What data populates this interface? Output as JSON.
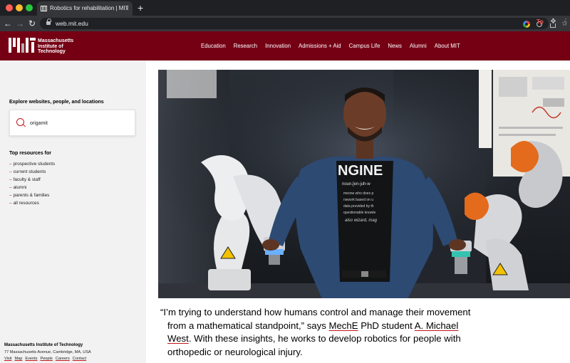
{
  "browser": {
    "tab_title": "Robotics for rehabilitation | MIT",
    "tab_close": "×",
    "new_tab": "+",
    "url": "web.mit.edu",
    "ext_tp": "Tp"
  },
  "header": {
    "logo_text": [
      "Massachusetts",
      "Institute of",
      "Technology"
    ],
    "nav": [
      "Education",
      "Research",
      "Innovation",
      "Admissions + Aid",
      "Campus Life",
      "News",
      "Alumni",
      "About MIT"
    ]
  },
  "sidebar": {
    "explore_title": "Explore websites, people, and locations",
    "search_value": "origamit",
    "resources_title": "Top resources for",
    "resources": [
      "prospective students",
      "current students",
      "faculty & staff",
      "alumni",
      "parents & families",
      "all resources"
    ],
    "footer": {
      "name": "Massachusetts Institute of Technology",
      "address": "77 Massachusetts Avenue, Cambridge, MA, USA",
      "links": [
        "Visit",
        "Map",
        "Events",
        "People",
        "Careers",
        "Contact"
      ]
    }
  },
  "hero": {
    "shirt_text": "NGINE",
    "shirt_sub": "noun.[en-juh-w",
    "shirt_lines": [
      "meone who does p",
      "nswork based on u",
      "data provided by th",
      "questionable knowle",
      "also wizard, mag"
    ]
  },
  "quote": {
    "line1": "“I’m trying to understand how humans control and manage their movement",
    "line2a": "from a mathematical standpoint,” says ",
    "link_meche": "MechE",
    "line2b": " PhD student ",
    "link_name1": "A. Michael",
    "link_name2": "West",
    "line3b": ". With these insights, he works to develop robotics for people with",
    "line4": "orthopedic or neurological injury."
  },
  "colors": {
    "mit_red": "#750014",
    "accent_red": "#c4161c"
  }
}
